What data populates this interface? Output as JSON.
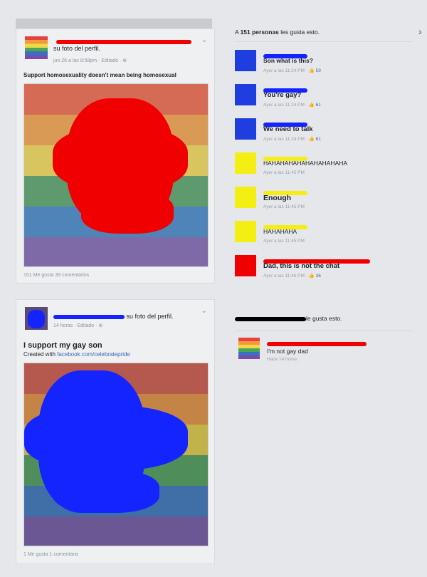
{
  "post1": {
    "action": "su foto del perfil.",
    "meta": "jun 26 a las 8:58pm · Editado ·",
    "message": "Support homosexuality doesn't mean being homosexual",
    "stats": "151 Me gusta   39 comentarios"
  },
  "post2": {
    "action": "su foto del perfil.",
    "meta": "14 horas · Editado ·",
    "message": "I support my gay son",
    "created_prefix": "Created with ",
    "created_link": "facebook.com/celebratepride",
    "stats": "1 Me gusta   1 comentario"
  },
  "thread1": {
    "likes_prefix": "A ",
    "likes_count": "151 personas",
    "likes_suffix": " les gusta esto.",
    "comments": [
      {
        "text": "Son what is this?",
        "time": "Ayer a las 11:24 PM ·",
        "likes": "59",
        "avatar": "blue"
      },
      {
        "text": "You're gay?",
        "time": "Ayer a las 11:24 PM ·",
        "likes": "61",
        "avatar": "blue"
      },
      {
        "text": "We need to talk",
        "time": "Ayer a las 11:24 PM ·",
        "likes": "61",
        "avatar": "blue"
      },
      {
        "text": "HAHAHAHAHAHAHAHAHAHA",
        "time": "Ayer a las 11:45 PM",
        "likes": "",
        "avatar": "yellow"
      },
      {
        "text": "Enough",
        "time": "Ayer a las 11:45 PM",
        "likes": "",
        "avatar": "yellow"
      },
      {
        "text": "HAHAHAHA",
        "time": "Ayer a las 11:45 PM",
        "likes": "",
        "avatar": "yellow"
      },
      {
        "text": "Dad, this is not the chat",
        "time": "Ayer a las 11:46 PM ·",
        "likes": "36",
        "avatar": "rainbow"
      }
    ]
  },
  "thread2": {
    "likes_suffix": "le gusta esto.",
    "comment_text": "I'm not gay dad",
    "comment_time": "Hace 14 horas"
  },
  "icons": {
    "chevron": "chevron-down-icon",
    "globe": "globe-icon",
    "like": "thumbs-up-icon",
    "next": "chevron-right-icon"
  },
  "colors": {
    "redact_red": "#f00000",
    "redact_blue": "#1424ff",
    "redact_yellow": "#f5ee12",
    "link": "#4267b2"
  }
}
